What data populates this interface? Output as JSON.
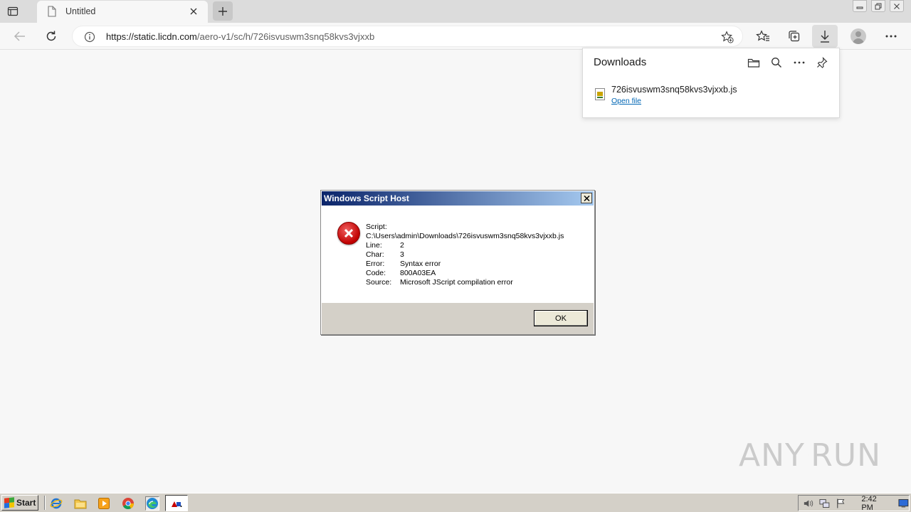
{
  "browser": {
    "tab": {
      "title": "Untitled"
    },
    "address": {
      "url_host": "https://static.licdn.com",
      "url_path": "/aero-v1/sc/h/726isvuswm3snq58kvs3vjxxb"
    }
  },
  "downloads": {
    "title": "Downloads",
    "items": [
      {
        "file_name": "726isvuswm3snq58kvs3vjxxb.js",
        "action": "Open file"
      }
    ]
  },
  "dialog": {
    "title": "Windows Script Host",
    "script_label": "Script:",
    "script_path": "C:\\Users\\admin\\Downloads\\726isvuswm3snq58kvs3vjxxb.js",
    "fields": [
      {
        "key": "Line:",
        "value": "2"
      },
      {
        "key": "Char:",
        "value": "3"
      },
      {
        "key": "Error:",
        "value": "Syntax error"
      },
      {
        "key": "Code:",
        "value": "800A03EA"
      },
      {
        "key": "Source:",
        "value": "Microsoft JScript compilation error"
      }
    ],
    "ok_label": "OK"
  },
  "watermark": {
    "left": "ANY",
    "right": "RUN"
  },
  "taskbar": {
    "start_label": "Start",
    "clock": "2:42 PM"
  }
}
